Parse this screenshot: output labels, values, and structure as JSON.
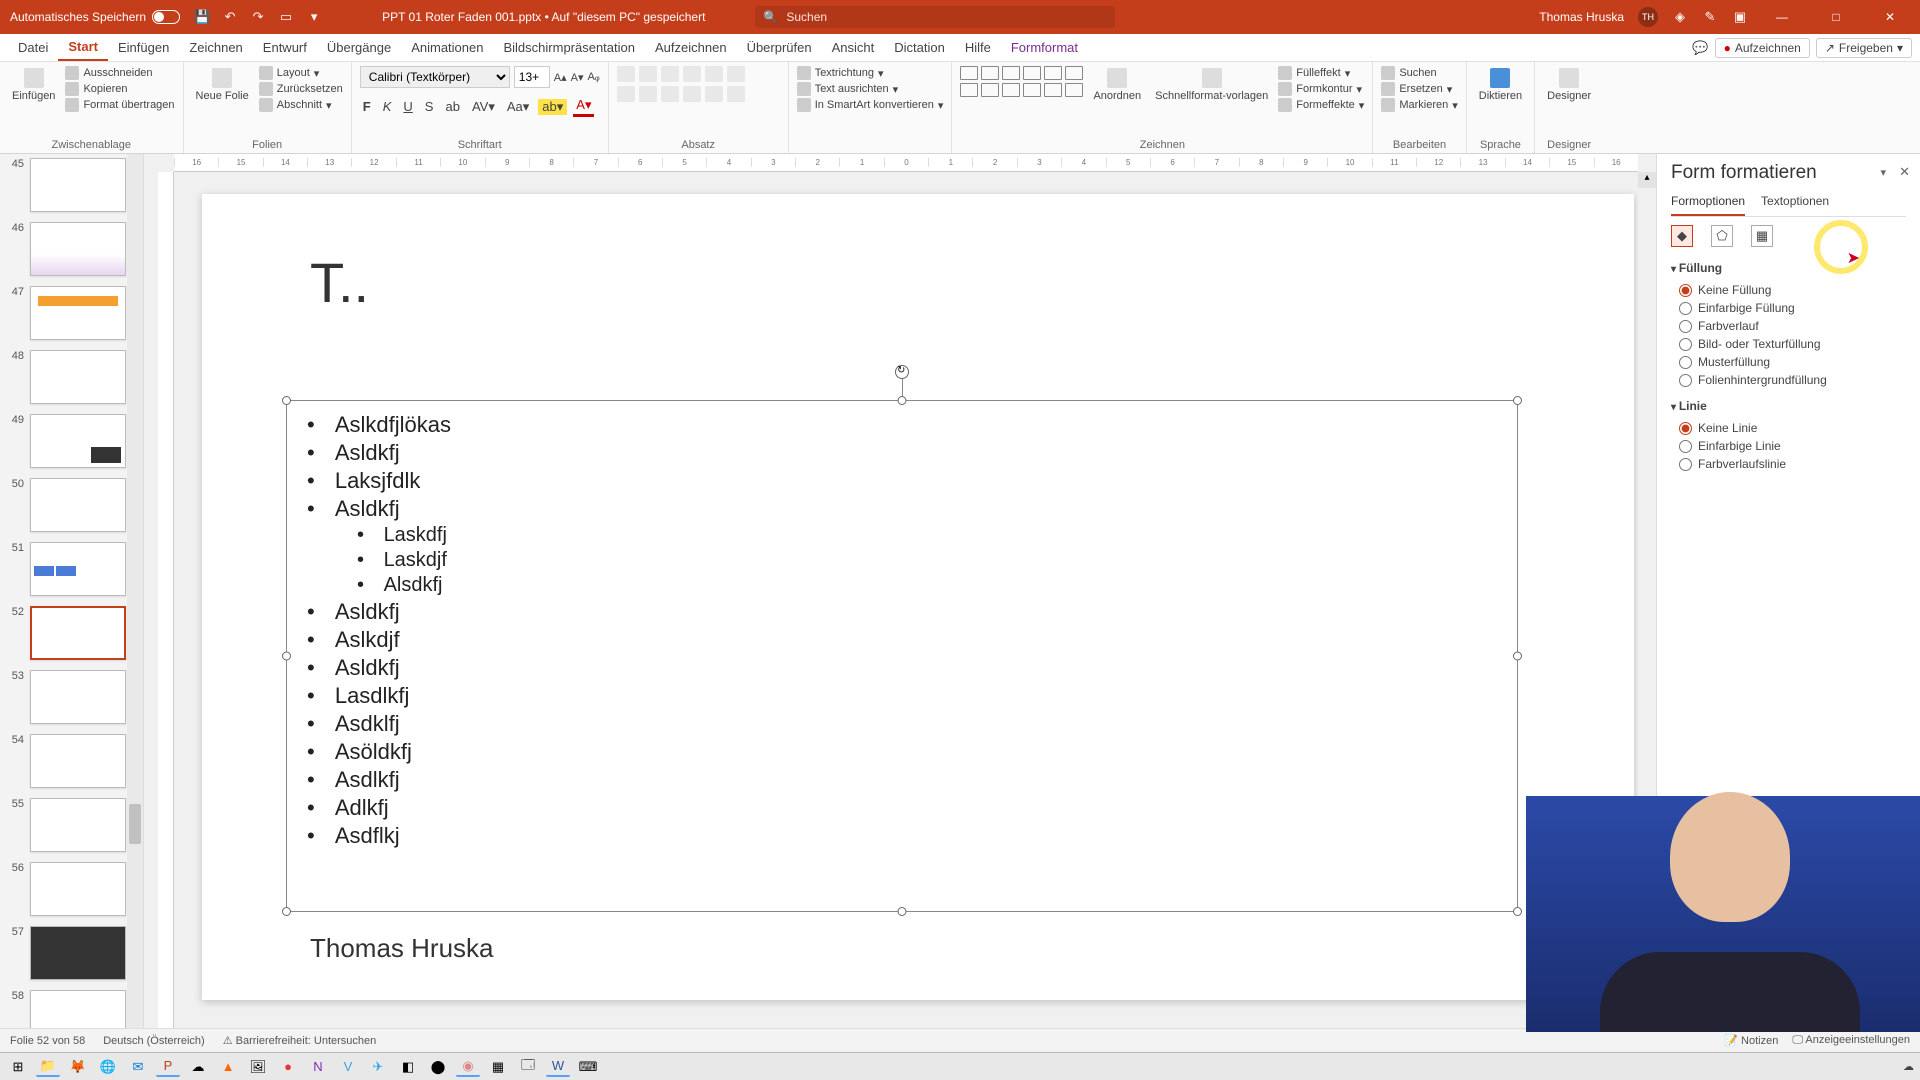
{
  "titlebar": {
    "autosave_label": "Automatisches Speichern",
    "filename": "PPT 01 Roter Faden 001.pptx • Auf \"diesem PC\" gespeichert",
    "search_placeholder": "Suchen",
    "user_name": "Thomas Hruska",
    "user_initials": "TH"
  },
  "tabs": {
    "items": [
      "Datei",
      "Start",
      "Einfügen",
      "Zeichnen",
      "Entwurf",
      "Übergänge",
      "Animationen",
      "Bildschirmpräsentation",
      "Aufzeichnen",
      "Überprüfen",
      "Ansicht",
      "Dictation",
      "Hilfe",
      "Formformat"
    ],
    "active": "Start",
    "record_btn": "Aufzeichnen",
    "share_btn": "Freigeben"
  },
  "ribbon": {
    "clipboard": {
      "paste": "Einfügen",
      "cut": "Ausschneiden",
      "copy": "Kopieren",
      "format": "Format übertragen",
      "label": "Zwischenablage"
    },
    "slides": {
      "new": "Neue Folie",
      "layout": "Layout",
      "reset": "Zurücksetzen",
      "section": "Abschnitt",
      "label": "Folien"
    },
    "font": {
      "name": "Calibri (Textkörper)",
      "size": "13+",
      "label": "Schriftart"
    },
    "paragraph": {
      "textdir": "Textrichtung",
      "align": "Text ausrichten",
      "smartart": "In SmartArt konvertieren",
      "label": "Absatz"
    },
    "drawing": {
      "arrange": "Anordnen",
      "quick": "Schnellformat-vorlagen",
      "fill": "Fülleffekt",
      "outline": "Formkontur",
      "effects": "Formeffekte",
      "label": "Zeichnen"
    },
    "editing": {
      "find": "Suchen",
      "replace": "Ersetzen",
      "select": "Markieren",
      "label": "Bearbeiten"
    },
    "voice": {
      "dictate": "Diktieren",
      "label": "Sprache"
    },
    "designer": {
      "btn": "Designer",
      "label": "Designer"
    }
  },
  "ruler_ticks": [
    "16",
    "15",
    "14",
    "13",
    "12",
    "11",
    "10",
    "9",
    "8",
    "7",
    "6",
    "5",
    "4",
    "3",
    "2",
    "1",
    "0",
    "1",
    "2",
    "3",
    "4",
    "5",
    "6",
    "7",
    "8",
    "9",
    "10",
    "11",
    "12",
    "13",
    "14",
    "15",
    "16"
  ],
  "thumbs": [
    {
      "n": "45"
    },
    {
      "n": "46"
    },
    {
      "n": "47"
    },
    {
      "n": "48"
    },
    {
      "n": "49"
    },
    {
      "n": "50"
    },
    {
      "n": "51"
    },
    {
      "n": "52",
      "selected": true
    },
    {
      "n": "53"
    },
    {
      "n": "54"
    },
    {
      "n": "55"
    },
    {
      "n": "56"
    },
    {
      "n": "57"
    },
    {
      "n": "58"
    }
  ],
  "slide": {
    "title": "T..",
    "bullets_l1": [
      "Aslkdfjlökas",
      "Asldkfj",
      "Laksjfdlk",
      "Asldkfj"
    ],
    "bullets_l2": [
      "Laskdfj",
      "Laskdjf",
      "Alsdkfj"
    ],
    "bullets_l1b": [
      "Asldkfj",
      "Aslkdjf",
      "Asldkfj",
      "Lasdlkfj",
      "Asdklfj",
      "Asöldkfj",
      "Asdlkfj",
      "Adlkfj",
      "Asdflkj"
    ],
    "footer": "Thomas Hruska"
  },
  "format_pane": {
    "title": "Form formatieren",
    "tab_shape": "Formoptionen",
    "tab_text": "Textoptionen",
    "section_fill": "Füllung",
    "fill_opts": [
      "Keine Füllung",
      "Einfarbige Füllung",
      "Farbverlauf",
      "Bild- oder Texturfüllung",
      "Musterfüllung",
      "Folienhintergrundfüllung"
    ],
    "section_line": "Linie",
    "line_opts": [
      "Keine Linie",
      "Einfarbige Linie",
      "Farbverlaufslinie"
    ]
  },
  "statusbar": {
    "slide": "Folie 52 von 58",
    "lang": "Deutsch (Österreich)",
    "access": "Barrierefreiheit: Untersuchen",
    "notes": "Notizen",
    "display": "Anzeigeeinstellungen"
  }
}
